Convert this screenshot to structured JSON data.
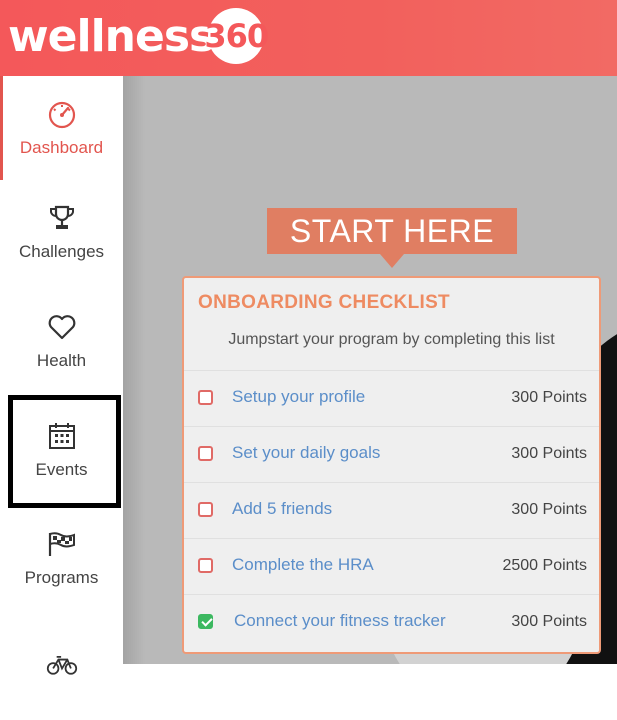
{
  "app": {
    "logo_text": "wellness",
    "logo_number": "360",
    "brand_color": "#f4585a"
  },
  "sidebar": {
    "items": [
      {
        "label": "Dashboard",
        "icon": "speedometer-icon",
        "active": true
      },
      {
        "label": "Challenges",
        "icon": "trophy-icon",
        "active": false
      },
      {
        "label": "Health",
        "icon": "heart-icon",
        "active": false
      },
      {
        "label": "Events",
        "icon": "calendar-icon",
        "active": false
      },
      {
        "label": "Programs",
        "icon": "flags-icon",
        "active": false
      },
      {
        "label": "",
        "icon": "bicycle-icon",
        "active": false
      }
    ]
  },
  "banner": {
    "label": "START HERE",
    "color": "#e07e62"
  },
  "checklist": {
    "title": "ONBOARDING CHECKLIST",
    "subtitle": "Jumpstart your program by completing this list",
    "items": [
      {
        "label": "Setup your profile",
        "points": "300 Points",
        "checked": false
      },
      {
        "label": "Set your daily goals",
        "points": "300 Points",
        "checked": false
      },
      {
        "label": "Add 5 friends",
        "points": "300 Points",
        "checked": false
      },
      {
        "label": "Complete the HRA",
        "points": "2500 Points",
        "checked": false
      },
      {
        "label": "Connect your fitness tracker",
        "points": "300 Points",
        "checked": true
      }
    ]
  }
}
